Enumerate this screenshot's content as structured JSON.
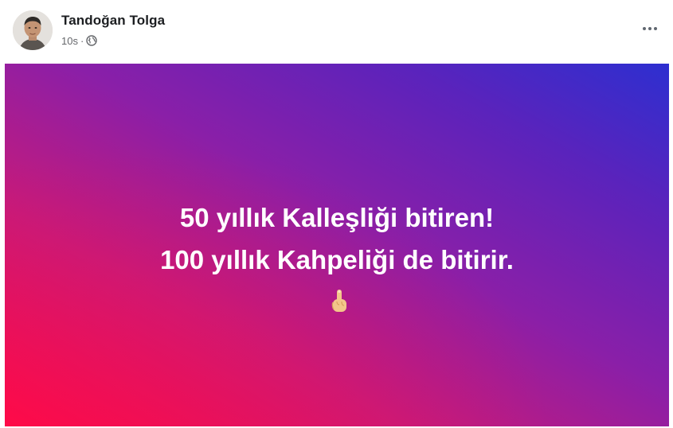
{
  "post": {
    "author_name": "Tandoğan Tolga",
    "time": "10s",
    "separator": "·",
    "privacy_icon": "globe-icon",
    "more_label": "···",
    "text_line_1": "50 yıllık Kalleşliği bitiren!",
    "text_line_2": "100 yıllık Kahpeliği de bitirir.",
    "emoji_icon": "index-finger-up-icon"
  },
  "colors": {
    "gradient_bottom_left": "#ff0a48",
    "gradient_middle": "#8a1fa8",
    "gradient_top_right": "#2d2fd0",
    "name_text": "#1c1e21",
    "meta_text": "#65676b"
  }
}
